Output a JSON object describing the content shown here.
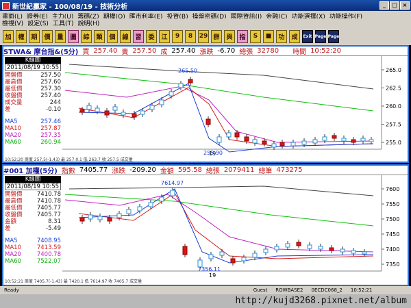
{
  "window": {
    "title": "新世紀贏家 - 100/08/19 - 技術分析"
  },
  "menu_row1": [
    "畫面(L)",
    "證券(E)",
    "主力(U)",
    "籌碼(Z)",
    "期權(Q)",
    "匯市利率(E)",
    "投資(B)",
    "操盤密碼(D)",
    "國際資訊(I)",
    "金融(C)",
    "功能選擇(X)",
    "功能操作(F)"
  ],
  "menu_row2": [
    "檢視(V)",
    "設定(S)",
    "工具(T)",
    "說明(H)"
  ],
  "toolbar": [
    "加",
    "權",
    "期",
    "價",
    "量",
    "圖",
    "綜",
    "類",
    "個",
    "線",
    "習",
    "委",
    "江",
    "9",
    "8",
    "29",
    "群",
    "與",
    "指",
    "S",
    "■",
    "功",
    "成",
    "Exit",
    "Page",
    "Page"
  ],
  "top": {
    "code": "STWA& 摩台指&(5分)",
    "buy_label": "買",
    "buy": "257.40",
    "sell_label": "賣",
    "sell": "257.50",
    "deal_label": "成",
    "deal": "257.40",
    "change_label": "漲跌",
    "change": "-6.70",
    "vol_label": "總張",
    "vol": "32780",
    "time_label": "時間",
    "time": "10:52:20",
    "box_title": "K線圖",
    "date": "2011/08/19 10:55",
    "rows": [
      {
        "k": "開盤價",
        "v": "257.50"
      },
      {
        "k": "最高價",
        "v": "257.60"
      },
      {
        "k": "最低價",
        "v": "257.30"
      },
      {
        "k": "收盤價",
        "v": "257.40"
      },
      {
        "k": "成交量",
        "v": "244"
      },
      {
        "k": "差",
        "v": "-0.10"
      }
    ],
    "ma": [
      {
        "k": "MA5",
        "v": "257.46",
        "color": "#1a3fd8"
      },
      {
        "k": "MA10",
        "v": "257.87",
        "color": "#d42020"
      },
      {
        "k": "MA20",
        "v": "257.35",
        "color": "#c020c0"
      },
      {
        "k": "MA60",
        "v": "260.94",
        "color": "#10b010"
      }
    ],
    "high_label": "265.50",
    "low_label": "255.90",
    "x_label": "19",
    "y_ticks": [
      "265.0",
      "262.5",
      "260.0",
      "257.5",
      "255.0"
    ],
    "status": "10:52:20  周度 257.5(-1.43)  最 257.0.1 低 263.7 收 257.5  成交量"
  },
  "bottom": {
    "code": "#001 加權(5分)",
    "idx_label": "指數",
    "idx": "7405.77",
    "change_label": "漲跌",
    "change": "-209.20",
    "amt_label": "金額",
    "amt": "595.58",
    "vol_label": "總張",
    "vol": "2079411",
    "cnt_label": "總筆",
    "cnt": "473275",
    "box_title": "K線圖",
    "date": "2011/08/19 10:55",
    "rows": [
      {
        "k": "開盤價",
        "v": "7410.78"
      },
      {
        "k": "最高價",
        "v": "7410.78"
      },
      {
        "k": "最低價",
        "v": "7405.77"
      },
      {
        "k": "收盤價",
        "v": "7405.77"
      },
      {
        "k": "金額",
        "v": "8.31"
      },
      {
        "k": "差",
        "v": "-5.49"
      }
    ],
    "ma": [
      {
        "k": "MA5",
        "v": "7408.95",
        "color": "#1a3fd8"
      },
      {
        "k": "MA10",
        "v": "7413.59",
        "color": "#d42020"
      },
      {
        "k": "MA20",
        "v": "7400.78",
        "color": "#c020c0"
      },
      {
        "k": "MA60",
        "v": "7522.07",
        "color": "#10b010"
      }
    ],
    "high_label": "7614.97",
    "low_label": "7356.11",
    "x_label": "19",
    "y_ticks": [
      "7600",
      "7550",
      "7500",
      "7450",
      "7400",
      "7350"
    ],
    "status": "10:52:21  周度 7405.7(-1.43)  最 7420.1 低 7614.97 收 7405.7  成交量"
  },
  "statusbar": [
    "Ready",
    "Guest",
    "ROWBASE2",
    "0ECDC068_2",
    "10:52:21"
  ],
  "watermark": "http://kujd3268.pixnet.net/album"
}
